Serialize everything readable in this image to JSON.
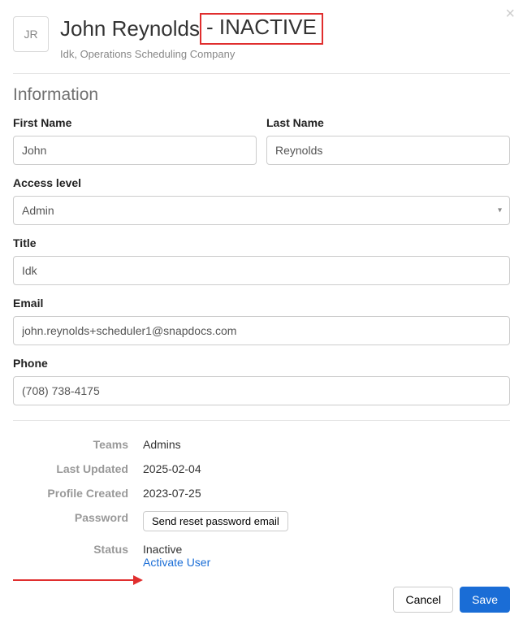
{
  "header": {
    "avatar_initials": "JR",
    "name": "John Reynolds",
    "separator": " - ",
    "status_badge": "INACTIVE",
    "subtitle": "Idk, Operations Scheduling Company"
  },
  "section_title": "Information",
  "fields": {
    "first_name": {
      "label": "First Name",
      "value": "John"
    },
    "last_name": {
      "label": "Last Name",
      "value": "Reynolds"
    },
    "access_level": {
      "label": "Access level",
      "value": "Admin"
    },
    "title": {
      "label": "Title",
      "value": "Idk"
    },
    "email": {
      "label": "Email",
      "value": "john.reynolds+scheduler1@snapdocs.com"
    },
    "phone": {
      "label": "Phone",
      "value": "(708) 738-4175"
    }
  },
  "details": {
    "teams": {
      "label": "Teams",
      "value": "Admins"
    },
    "last_updated": {
      "label": "Last Updated",
      "value": "2025-02-04"
    },
    "profile_created": {
      "label": "Profile Created",
      "value": "2023-07-25"
    },
    "password": {
      "label": "Password",
      "button": "Send reset password email"
    },
    "status": {
      "label": "Status",
      "value": "Inactive",
      "action": "Activate User"
    }
  },
  "footer": {
    "cancel": "Cancel",
    "save": "Save"
  }
}
